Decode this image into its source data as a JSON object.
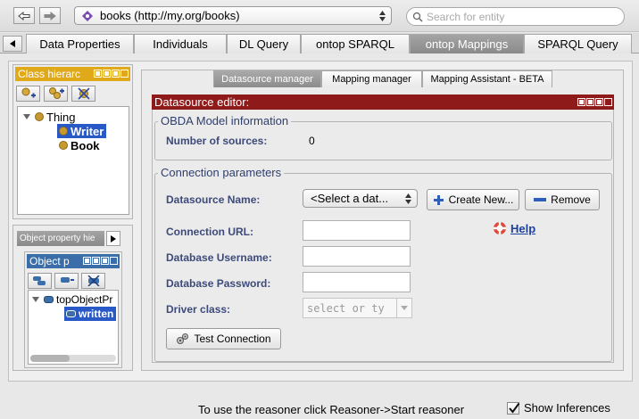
{
  "toolbar": {
    "back_icon": "back-arrow-icon",
    "forward_icon": "forward-arrow-icon",
    "ontology_label": "books (http://my.org/books)",
    "search_placeholder": "Search for entity"
  },
  "tabs": [
    {
      "label": "Data Properties",
      "active": false
    },
    {
      "label": "Individuals",
      "active": false
    },
    {
      "label": "DL Query",
      "active": false
    },
    {
      "label": "ontop SPARQL",
      "active": false
    },
    {
      "label": "ontop Mappings",
      "active": true
    },
    {
      "label": "SPARQL Query",
      "active": false
    }
  ],
  "class_panel": {
    "title": "Class hierarc",
    "tree": [
      {
        "label": "Thing",
        "selected": false
      },
      {
        "label": "Writer",
        "selected": true
      },
      {
        "label": "Book",
        "selected": false
      }
    ]
  },
  "object_panel": {
    "tab_label": "Object property hie",
    "title": "Object p",
    "tree": [
      {
        "label": "topObjectPr",
        "selected": false
      },
      {
        "label": "written",
        "selected": true
      }
    ]
  },
  "subtabs": [
    "Datasource manager",
    "Mapping manager",
    "Mapping Assistant - BETA"
  ],
  "datasource_editor": {
    "title": "Datasource editor:",
    "model_group": "OBDA Model information",
    "num_sources_label": "Number of sources:",
    "num_sources_value": "0",
    "conn_group": "Connection parameters",
    "ds_name_label": "Datasource Name:",
    "ds_select": "<Select a dat...",
    "create_btn": "Create New...",
    "remove_btn": "Remove",
    "help_label": "Help",
    "url_label": "Connection URL:",
    "user_label": "Database Username:",
    "pass_label": "Database Password:",
    "driver_label": "Driver class:",
    "driver_placeholder": "select or ty",
    "test_btn": "Test Connection"
  },
  "status": {
    "message": "To use the reasoner click Reasoner->Start reasoner",
    "show_inferences": "Show Inferences",
    "show_inferences_checked": true
  },
  "colors": {
    "orange_header": "#e0a91a",
    "blue_header": "#3b6ea8",
    "editor_header": "#8f1a1a",
    "selection": "#2958c7"
  }
}
